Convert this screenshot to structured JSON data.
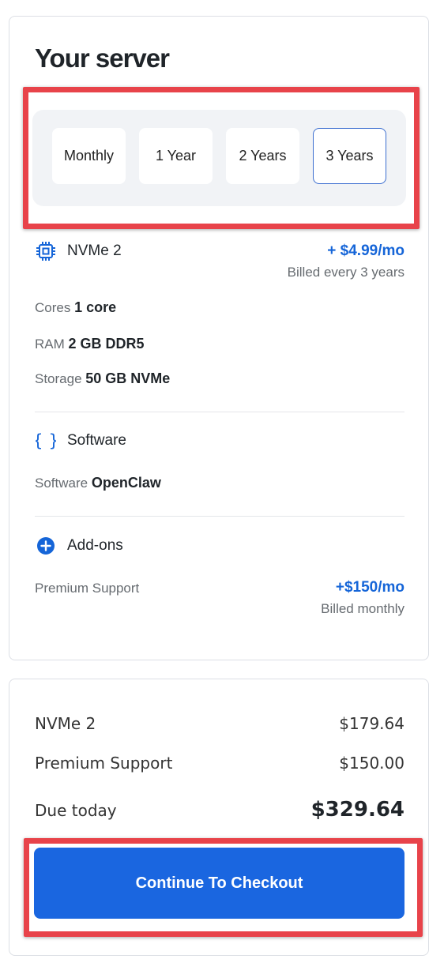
{
  "server": {
    "title": "Your server",
    "billing_periods": [
      "Monthly",
      "1 Year",
      "2 Years",
      "3 Years"
    ],
    "selected_period": "3 Years",
    "plan": {
      "name": "NVMe 2",
      "price": "+ $4.99/mo",
      "billing_note": "Billed every 3 years",
      "icon": "chip-icon"
    },
    "specs": {
      "cores_label": "Cores",
      "cores_value": "1 core",
      "ram_label": "RAM",
      "ram_value": "2 GB DDR5",
      "storage_label": "Storage",
      "storage_value": "50 GB NVMe"
    },
    "software": {
      "heading": "Software",
      "icon": "braces-icon",
      "label": "Software",
      "value": "OpenClaw"
    },
    "addons": {
      "heading": "Add-ons",
      "icon": "plus-circle-icon",
      "item_label": "Premium Support",
      "item_price": "+$150/mo",
      "item_billing": "Billed monthly"
    }
  },
  "summary": {
    "rows": [
      {
        "label": "NVMe 2",
        "value": "$179.64"
      },
      {
        "label": "Premium Support",
        "value": "$150.00"
      }
    ],
    "total_label": "Due today",
    "total_value": "$329.64",
    "checkout_label": "Continue To Checkout"
  },
  "colors": {
    "accent": "#1a66e0",
    "highlight": "#e8434a"
  }
}
